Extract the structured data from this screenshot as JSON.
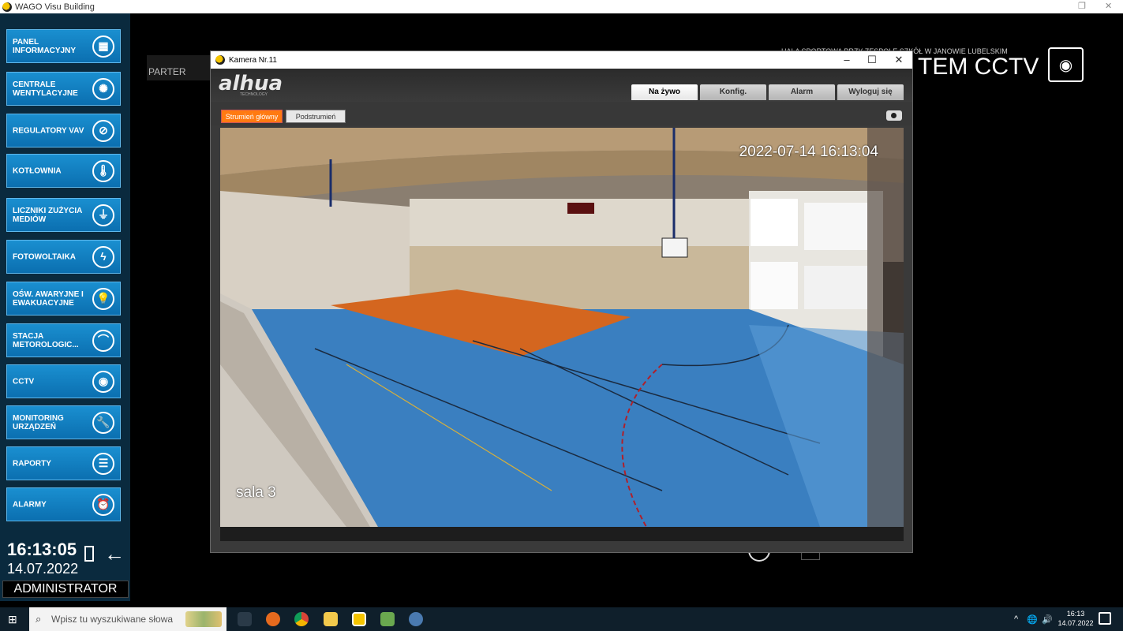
{
  "app": {
    "title": "WAGO Visu Building"
  },
  "sidebar": {
    "items": [
      {
        "label": "PANEL INFORMACYJNY",
        "icon": "panel-icon",
        "glyph": "▦"
      },
      {
        "label": "CENTRALE WENTYLACYJNE",
        "icon": "fan-icon",
        "glyph": "✺"
      },
      {
        "label": "REGULATORY VAV",
        "icon": "gauge-icon",
        "glyph": "⊘"
      },
      {
        "label": "KOTŁOWNIA",
        "icon": "thermometer-icon",
        "glyph": "🌡"
      },
      {
        "label": "LICZNIKI ZUŻYCIA MEDIÓW",
        "icon": "meter-icon",
        "glyph": "⏚"
      },
      {
        "label": "FOTOWOLTAIKA",
        "icon": "lightning-icon",
        "glyph": "ϟ"
      },
      {
        "label": "OŚW. AWARYJNE I EWAKUACYJNE",
        "icon": "bulb-icon",
        "glyph": "💡"
      },
      {
        "label": "STACJA METOROLOGIC...",
        "icon": "weather-icon",
        "glyph": "⌒"
      },
      {
        "label": "CCTV",
        "icon": "camera-icon",
        "glyph": "◉"
      },
      {
        "label": "MONITORING URZĄDZEŃ",
        "icon": "wrench-icon",
        "glyph": "🔧"
      },
      {
        "label": "RAPORTY",
        "icon": "list-icon",
        "glyph": "☰"
      },
      {
        "label": "ALARMY",
        "icon": "alarm-icon",
        "glyph": "⏰"
      }
    ],
    "clock": "16:13:05",
    "date": "14.07.2022",
    "user": "ADMINISTRATOR"
  },
  "floor": "PARTER",
  "header": {
    "school": "HALA SPORTOWA PRZY ZESPOLE SZKÓŁ W JANOWIE LUBELSKIM",
    "title": "TEM CCTV"
  },
  "camera_window": {
    "title": "Kamera Nr.11",
    "brand": "alhua",
    "brand_sub": "TECHNOLOGY",
    "tabs": [
      "Na żywo",
      "Konfig.",
      "Alarm",
      "Wyloguj się"
    ],
    "stream_main": "Strumień główny",
    "stream_sub": "Podstrumień",
    "osd_time": "2022-07-14 16:13:04",
    "osd_name": "sala 3"
  },
  "taskbar": {
    "search_placeholder": "Wpisz tu wyszukiwane słowa",
    "time": "16:13",
    "date": "14.07.2022"
  },
  "colors": {
    "sidebar_button": "#1a8fd0",
    "stream_active": "#ff7a12",
    "court_blue": "#3a7fc0",
    "court_orange": "#d4661f"
  }
}
